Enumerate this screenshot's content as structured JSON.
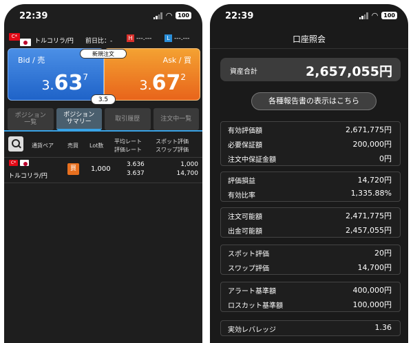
{
  "status": {
    "time": "22:39",
    "battery": "100"
  },
  "left": {
    "pair": {
      "flag_tr": "C*",
      "name": "トルコリラ/円",
      "prev_label": "前日比：-"
    },
    "high": {
      "tag": "H",
      "value": "---.---"
    },
    "low": {
      "tag": "L",
      "value": "---.---"
    },
    "new_order_label": "新規注文",
    "bid": {
      "label": "Bid / 売",
      "small": "3.",
      "big": "63",
      "pip": "7"
    },
    "ask": {
      "label": "Ask / 買",
      "small": "3.",
      "big": "67",
      "pip": "2"
    },
    "spread": "3.5",
    "tabs": [
      {
        "label": "ポジション\n一覧"
      },
      {
        "label": "ポジション\nサマリー"
      },
      {
        "label": "取引履歴"
      },
      {
        "label": "注文中一覧"
      }
    ],
    "columns": {
      "pair": "通貨ペア",
      "side": "売買",
      "lot": "Lot数",
      "avg_rate": "平均レート",
      "eval_rate": "評価レート",
      "spot_eval": "スポット評価",
      "swap_eval": "スワップ評価"
    },
    "row": {
      "pair": "トルコリラ/円",
      "side": "買",
      "lot": "1,000",
      "avg_rate": "3.636",
      "eval_rate": "3.637",
      "spot_eval": "1,000",
      "swap_eval": "14,700"
    }
  },
  "right": {
    "title": "口座照会",
    "total_label": "資産合計",
    "total_value": "2,657,055円",
    "report_button": "各種報告書の表示はこちら",
    "groups": [
      [
        {
          "k": "有効評価額",
          "v": "2,671,775円"
        },
        {
          "k": "必要保証額",
          "v": "200,000円"
        },
        {
          "k": "注文中保証金額",
          "v": "0円"
        }
      ],
      [
        {
          "k": "評価損益",
          "v": "14,720円"
        },
        {
          "k": "有効比率",
          "v": "1,335.88%"
        }
      ],
      [
        {
          "k": "注文可能額",
          "v": "2,471,775円"
        },
        {
          "k": "出金可能額",
          "v": "2,457,055円"
        }
      ],
      [
        {
          "k": "スポット評価",
          "v": "20円"
        },
        {
          "k": "スワップ評価",
          "v": "14,700円"
        }
      ],
      [
        {
          "k": "アラート基準額",
          "v": "400,000円"
        },
        {
          "k": "ロスカット基準額",
          "v": "100,000円"
        }
      ],
      [
        {
          "k": "実効レバレッジ",
          "v": "1.36"
        }
      ]
    ]
  }
}
